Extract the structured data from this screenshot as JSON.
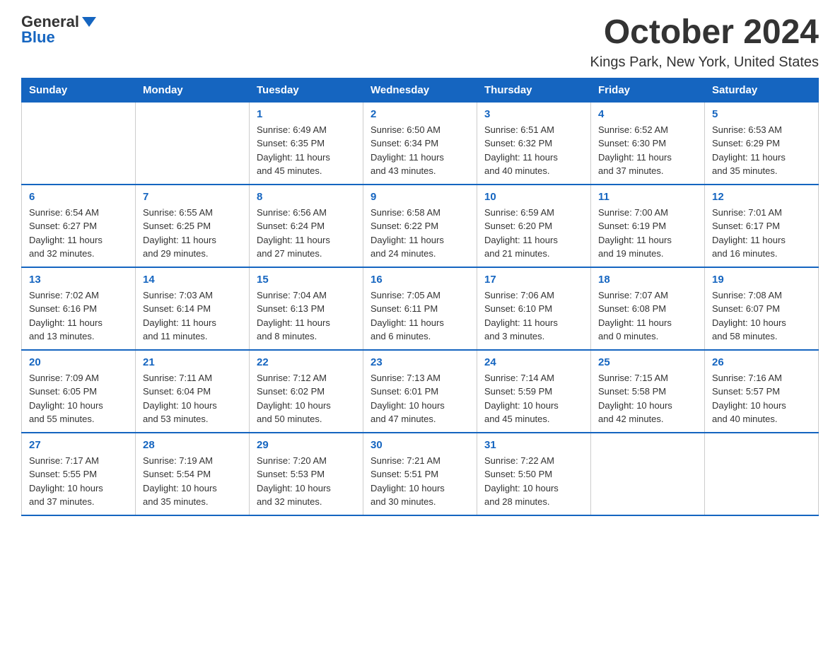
{
  "logo": {
    "general": "General",
    "blue": "Blue"
  },
  "title": "October 2024",
  "location": "Kings Park, New York, United States",
  "days_of_week": [
    "Sunday",
    "Monday",
    "Tuesday",
    "Wednesday",
    "Thursday",
    "Friday",
    "Saturday"
  ],
  "weeks": [
    [
      {
        "day": "",
        "info": ""
      },
      {
        "day": "",
        "info": ""
      },
      {
        "day": "1",
        "info": "Sunrise: 6:49 AM\nSunset: 6:35 PM\nDaylight: 11 hours\nand 45 minutes."
      },
      {
        "day": "2",
        "info": "Sunrise: 6:50 AM\nSunset: 6:34 PM\nDaylight: 11 hours\nand 43 minutes."
      },
      {
        "day": "3",
        "info": "Sunrise: 6:51 AM\nSunset: 6:32 PM\nDaylight: 11 hours\nand 40 minutes."
      },
      {
        "day": "4",
        "info": "Sunrise: 6:52 AM\nSunset: 6:30 PM\nDaylight: 11 hours\nand 37 minutes."
      },
      {
        "day": "5",
        "info": "Sunrise: 6:53 AM\nSunset: 6:29 PM\nDaylight: 11 hours\nand 35 minutes."
      }
    ],
    [
      {
        "day": "6",
        "info": "Sunrise: 6:54 AM\nSunset: 6:27 PM\nDaylight: 11 hours\nand 32 minutes."
      },
      {
        "day": "7",
        "info": "Sunrise: 6:55 AM\nSunset: 6:25 PM\nDaylight: 11 hours\nand 29 minutes."
      },
      {
        "day": "8",
        "info": "Sunrise: 6:56 AM\nSunset: 6:24 PM\nDaylight: 11 hours\nand 27 minutes."
      },
      {
        "day": "9",
        "info": "Sunrise: 6:58 AM\nSunset: 6:22 PM\nDaylight: 11 hours\nand 24 minutes."
      },
      {
        "day": "10",
        "info": "Sunrise: 6:59 AM\nSunset: 6:20 PM\nDaylight: 11 hours\nand 21 minutes."
      },
      {
        "day": "11",
        "info": "Sunrise: 7:00 AM\nSunset: 6:19 PM\nDaylight: 11 hours\nand 19 minutes."
      },
      {
        "day": "12",
        "info": "Sunrise: 7:01 AM\nSunset: 6:17 PM\nDaylight: 11 hours\nand 16 minutes."
      }
    ],
    [
      {
        "day": "13",
        "info": "Sunrise: 7:02 AM\nSunset: 6:16 PM\nDaylight: 11 hours\nand 13 minutes."
      },
      {
        "day": "14",
        "info": "Sunrise: 7:03 AM\nSunset: 6:14 PM\nDaylight: 11 hours\nand 11 minutes."
      },
      {
        "day": "15",
        "info": "Sunrise: 7:04 AM\nSunset: 6:13 PM\nDaylight: 11 hours\nand 8 minutes."
      },
      {
        "day": "16",
        "info": "Sunrise: 7:05 AM\nSunset: 6:11 PM\nDaylight: 11 hours\nand 6 minutes."
      },
      {
        "day": "17",
        "info": "Sunrise: 7:06 AM\nSunset: 6:10 PM\nDaylight: 11 hours\nand 3 minutes."
      },
      {
        "day": "18",
        "info": "Sunrise: 7:07 AM\nSunset: 6:08 PM\nDaylight: 11 hours\nand 0 minutes."
      },
      {
        "day": "19",
        "info": "Sunrise: 7:08 AM\nSunset: 6:07 PM\nDaylight: 10 hours\nand 58 minutes."
      }
    ],
    [
      {
        "day": "20",
        "info": "Sunrise: 7:09 AM\nSunset: 6:05 PM\nDaylight: 10 hours\nand 55 minutes."
      },
      {
        "day": "21",
        "info": "Sunrise: 7:11 AM\nSunset: 6:04 PM\nDaylight: 10 hours\nand 53 minutes."
      },
      {
        "day": "22",
        "info": "Sunrise: 7:12 AM\nSunset: 6:02 PM\nDaylight: 10 hours\nand 50 minutes."
      },
      {
        "day": "23",
        "info": "Sunrise: 7:13 AM\nSunset: 6:01 PM\nDaylight: 10 hours\nand 47 minutes."
      },
      {
        "day": "24",
        "info": "Sunrise: 7:14 AM\nSunset: 5:59 PM\nDaylight: 10 hours\nand 45 minutes."
      },
      {
        "day": "25",
        "info": "Sunrise: 7:15 AM\nSunset: 5:58 PM\nDaylight: 10 hours\nand 42 minutes."
      },
      {
        "day": "26",
        "info": "Sunrise: 7:16 AM\nSunset: 5:57 PM\nDaylight: 10 hours\nand 40 minutes."
      }
    ],
    [
      {
        "day": "27",
        "info": "Sunrise: 7:17 AM\nSunset: 5:55 PM\nDaylight: 10 hours\nand 37 minutes."
      },
      {
        "day": "28",
        "info": "Sunrise: 7:19 AM\nSunset: 5:54 PM\nDaylight: 10 hours\nand 35 minutes."
      },
      {
        "day": "29",
        "info": "Sunrise: 7:20 AM\nSunset: 5:53 PM\nDaylight: 10 hours\nand 32 minutes."
      },
      {
        "day": "30",
        "info": "Sunrise: 7:21 AM\nSunset: 5:51 PM\nDaylight: 10 hours\nand 30 minutes."
      },
      {
        "day": "31",
        "info": "Sunrise: 7:22 AM\nSunset: 5:50 PM\nDaylight: 10 hours\nand 28 minutes."
      },
      {
        "day": "",
        "info": ""
      },
      {
        "day": "",
        "info": ""
      }
    ]
  ]
}
